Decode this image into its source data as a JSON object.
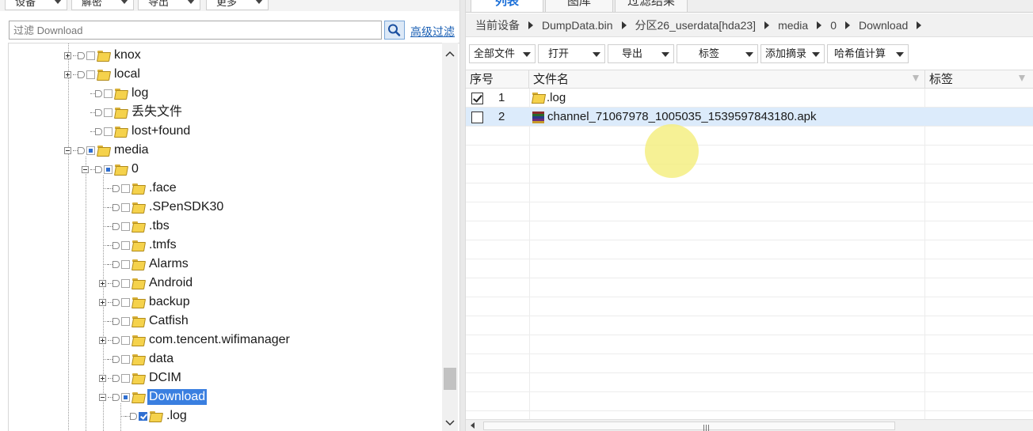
{
  "left_toolbar": {
    "buttons": [
      {
        "label": "设备"
      },
      {
        "label": "解密"
      },
      {
        "label": "导出"
      },
      {
        "label": "更多"
      }
    ]
  },
  "search": {
    "placeholder": "过滤 Download",
    "value": "",
    "advanced_filter_label": "高级过滤",
    "search_icon": "magnifier-icon"
  },
  "tree": {
    "items": [
      {
        "label": "knox",
        "expander": "plus",
        "check": "none"
      },
      {
        "label": "local",
        "expander": "plus",
        "check": "none"
      },
      {
        "label": "log",
        "expander": "none",
        "check": "none"
      },
      {
        "label": "丢失文件",
        "expander": "none",
        "check": "none"
      },
      {
        "label": "lost+found",
        "expander": "none",
        "check": "none"
      },
      {
        "label": "media",
        "expander": "minus",
        "check": "partial"
      },
      {
        "label": "0",
        "expander": "minus",
        "check": "partial"
      },
      {
        "label": ".face",
        "expander": "none",
        "check": "none"
      },
      {
        "label": ".SPenSDK30",
        "expander": "none",
        "check": "none"
      },
      {
        "label": ".tbs",
        "expander": "none",
        "check": "none"
      },
      {
        "label": ".tmfs",
        "expander": "none",
        "check": "none"
      },
      {
        "label": "Alarms",
        "expander": "none",
        "check": "none"
      },
      {
        "label": "Android",
        "expander": "plus",
        "check": "none"
      },
      {
        "label": "backup",
        "expander": "plus",
        "check": "none"
      },
      {
        "label": "Catfish",
        "expander": "none",
        "check": "none"
      },
      {
        "label": "com.tencent.wifimanager",
        "expander": "plus",
        "check": "none"
      },
      {
        "label": "data",
        "expander": "none",
        "check": "none"
      },
      {
        "label": "DCIM",
        "expander": "plus",
        "check": "none"
      },
      {
        "label": "Download",
        "expander": "minus",
        "check": "partial",
        "selected": true
      },
      {
        "label": ".log",
        "expander": "none",
        "check": "checked"
      }
    ]
  },
  "tabs": [
    {
      "label": "列表",
      "active": true
    },
    {
      "label": "图库",
      "active": false
    },
    {
      "label": "过滤结果",
      "active": false
    }
  ],
  "breadcrumb": [
    "当前设备",
    "DumpData.bin",
    "分区26_userdata[hda23]",
    "media",
    "0",
    "Download"
  ],
  "actions": [
    {
      "label": "全部文件"
    },
    {
      "label": "打开"
    },
    {
      "label": "导出"
    },
    {
      "label": "标签"
    },
    {
      "label": "添加摘录"
    },
    {
      "label": "哈希值计算"
    }
  ],
  "grid": {
    "columns": [
      {
        "label": "序号"
      },
      {
        "label": "文件名"
      },
      {
        "label": "标签"
      }
    ],
    "rows": [
      {
        "checked": true,
        "index": "1",
        "name": ".log",
        "type": "folder",
        "tag": ""
      },
      {
        "checked": false,
        "index": "2",
        "name": "channel_71067978_1005035_1539597843180.apk",
        "type": "apk",
        "tag": "",
        "selected": true
      }
    ]
  },
  "colors": {
    "accent": "#3a7fe0",
    "link": "#1a5fb4",
    "selected_row": "#dcebfb",
    "tab_active": "#1a6fd8",
    "cursor_highlight": "#f5ee82"
  }
}
